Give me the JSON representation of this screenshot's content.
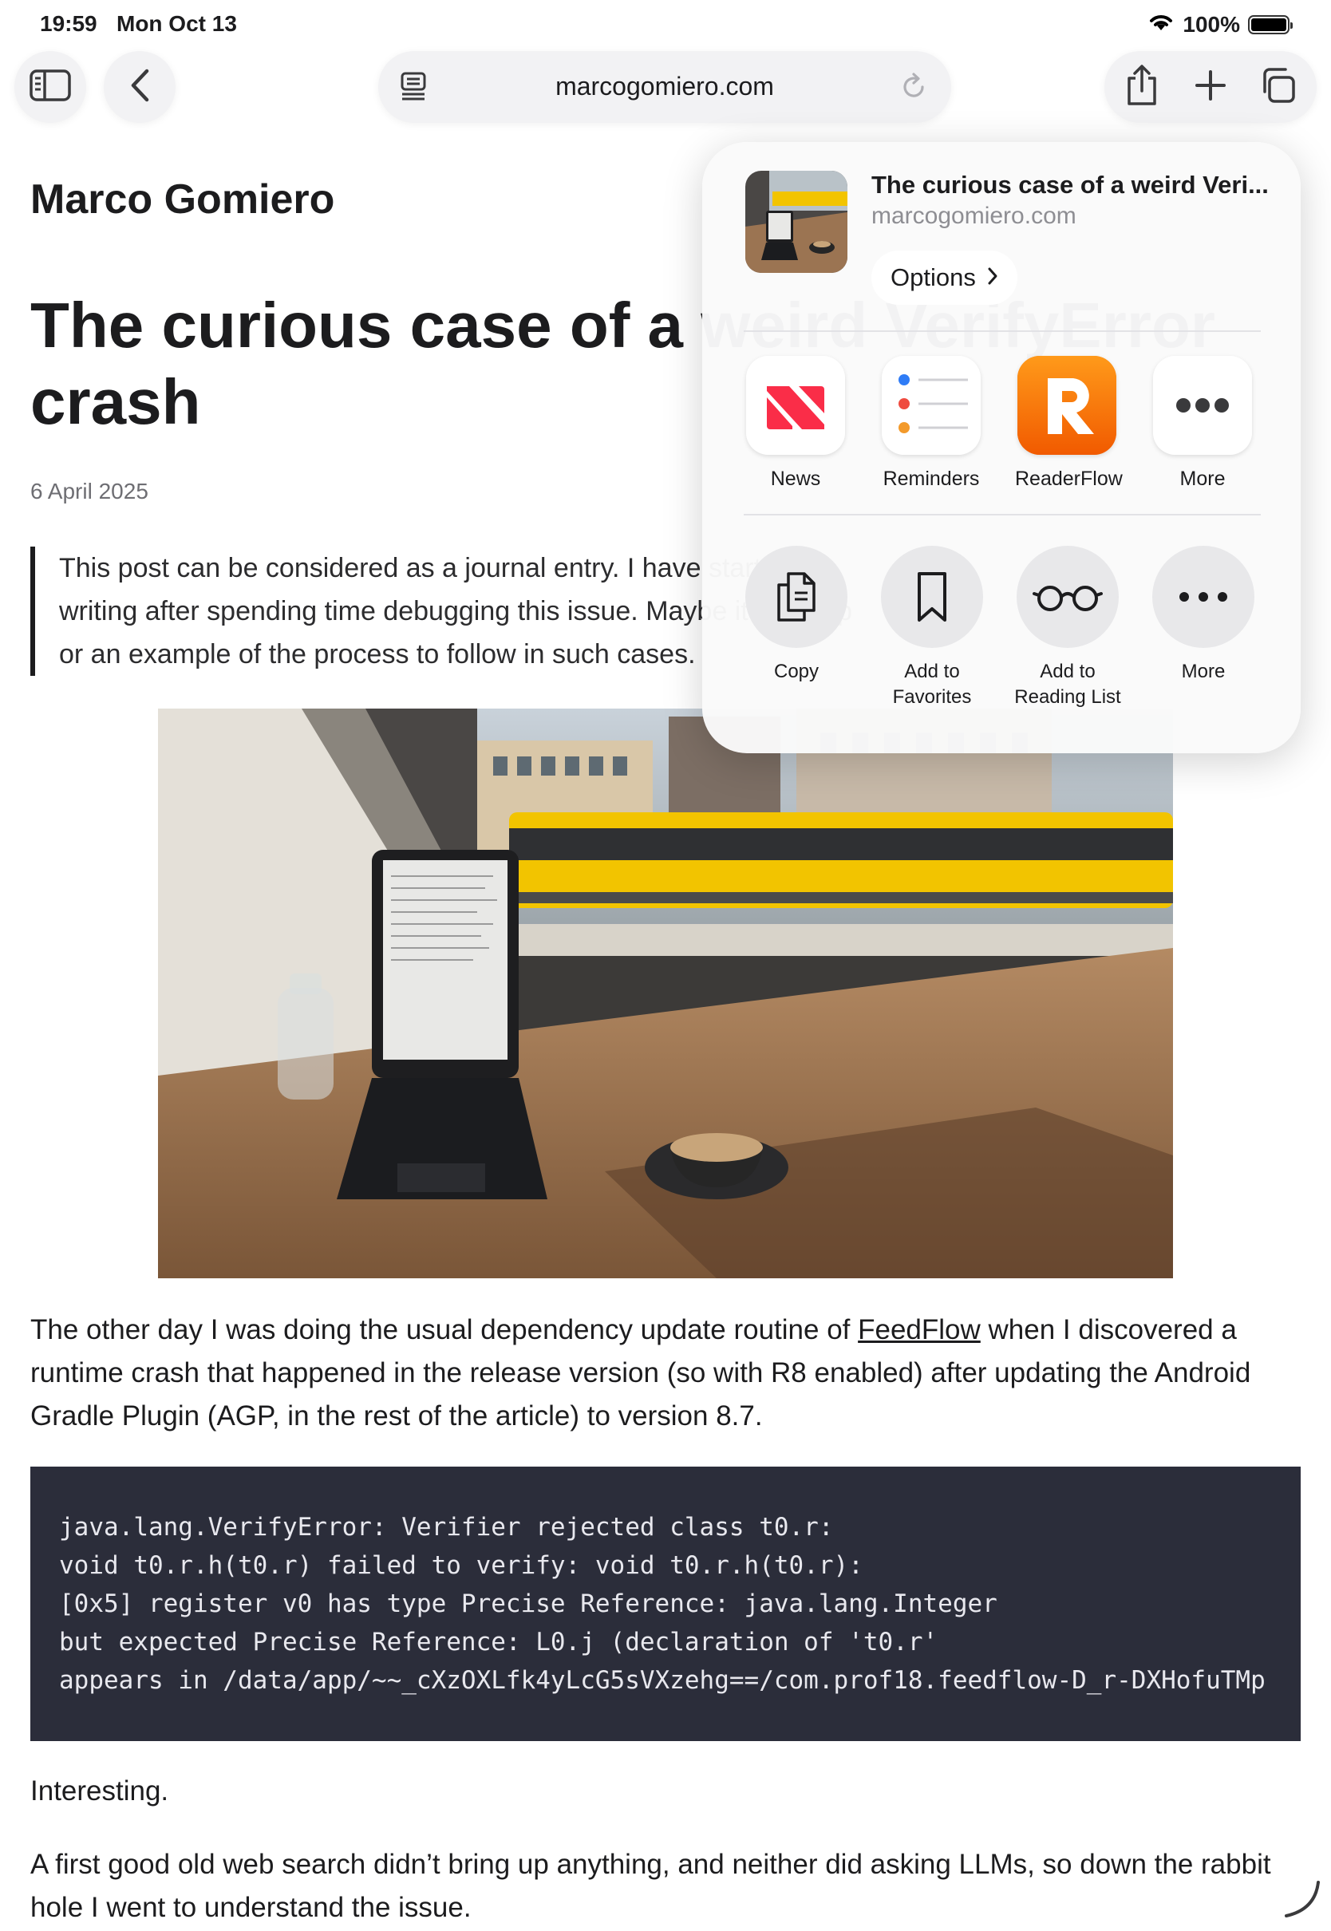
{
  "status_bar": {
    "time": "19:59",
    "date": "Mon Oct 13",
    "battery": "100%",
    "battery_level": 1.0
  },
  "toolbar": {
    "url": "marcogomiero.com"
  },
  "article": {
    "site_title": "Marco Gomiero",
    "title": "The curious case of a weird VerifyError\ncrash",
    "date": "6 April 2025",
    "quote_lines": [
      "This post can be considered as a journal entry. I have started",
      "writing after spending time debugging this issue. Maybe it will help",
      "or an example of the process to follow in such cases."
    ],
    "p1_before_link": "The other day I was doing the usual dependency update routine of ",
    "p1_link": "FeedFlow",
    "p1_after_link": " when I discovered a runtime crash that happened in the release version (so with R8 enabled) after updating the Android Gradle Plugin (AGP, in the rest of the article) to version 8.7.",
    "code_lines": [
      "java.lang.VerifyError: Verifier rejected class t0.r:",
      "void t0.r.h(t0.r) failed to verify: void t0.r.h(t0.r):",
      "[0x5] register v0 has type Precise Reference: java.lang.Integer",
      "but expected Precise Reference: L0.j (declaration of 't0.r'",
      "appears in /data/app/~~_cXzOXLfk4yLcG5sVXzehg==/com.prof18.feedflow-D_r-DXHofuTMp"
    ],
    "p2": "Interesting.",
    "p3": "A first good old web search didn’t bring up anything, and neither did asking LLMs, so down the rabbit hole I went to understand the issue."
  },
  "share_sheet": {
    "preview_title": "The curious case of a weird Veri...",
    "preview_domain": "marcogomiero.com",
    "options_label": "Options",
    "apps": [
      {
        "label": "News",
        "icon": "news-icon"
      },
      {
        "label": "Reminders",
        "icon": "reminders-icon"
      },
      {
        "label": "ReaderFlow",
        "icon": "readerflow-icon"
      },
      {
        "label": "More",
        "icon": "more-icon"
      }
    ],
    "actions": [
      {
        "label": "Copy",
        "icon": "copy-icon"
      },
      {
        "label": "Add to\nFavorites",
        "icon": "bookmark-icon"
      },
      {
        "label": "Add to\nReading List",
        "icon": "glasses-icon"
      },
      {
        "label": "More",
        "icon": "ellipsis-icon"
      }
    ]
  },
  "colors": {
    "code_background": "#2b2d3a",
    "readerflow_orange": "#ff7a00",
    "news_red": "#fa2d48"
  }
}
